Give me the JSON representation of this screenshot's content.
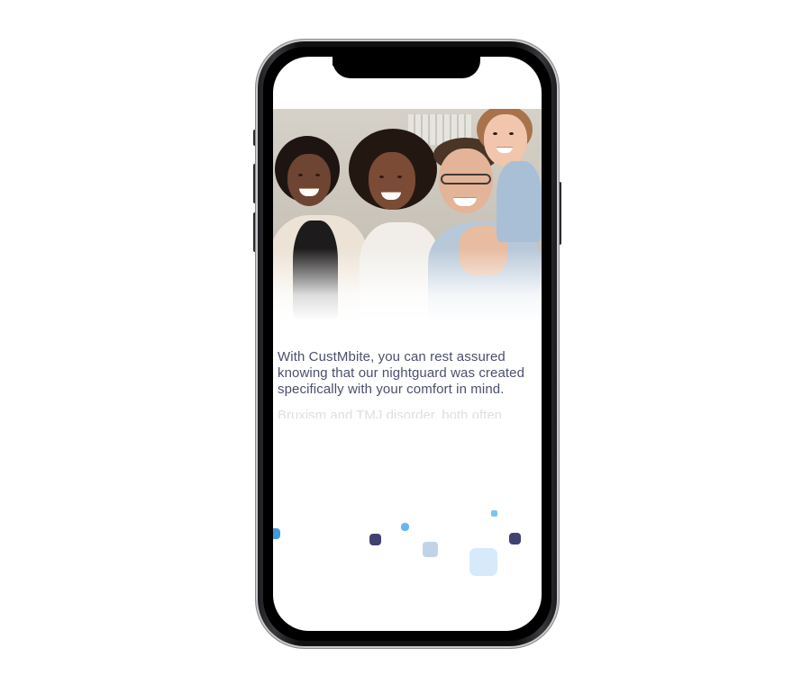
{
  "screen": {
    "main_text": "With CustMbite, you can rest assured knowing that our nightguard was created specifically with your comfort in mind.",
    "faded_text": "Bruxism and TMJ disorder, both often"
  },
  "photo": {
    "subject": "family-photo"
  },
  "colors": {
    "text": "#4b4f6e",
    "accent_blue": "#4aa8e8",
    "light_blue": "#cfe6f7",
    "navy": "#3f3f6e"
  }
}
